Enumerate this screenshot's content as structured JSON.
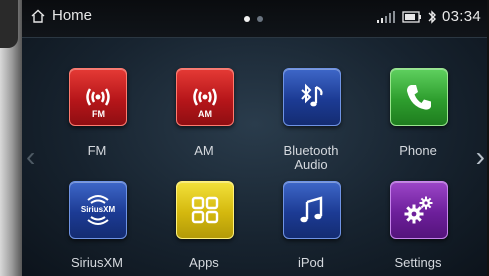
{
  "statusbar": {
    "title": "Home",
    "time": "03:34",
    "page_dots": 2,
    "active_dot": 0
  },
  "apps": [
    {
      "label": "FM",
      "icon": "fm-radio-icon",
      "color": "#c8201f",
      "badge": "FM"
    },
    {
      "label": "AM",
      "icon": "am-radio-icon",
      "color": "#c8201f",
      "badge": "AM"
    },
    {
      "label": "Bluetooth\nAudio",
      "icon": "bluetooth-audio-icon",
      "color": "#1f3f9c"
    },
    {
      "label": "Phone",
      "icon": "phone-icon",
      "color": "#35a835"
    },
    {
      "label": "SiriusXM",
      "icon": "siriusxm-icon",
      "color": "#1f3f9c",
      "badge": "SiriusXM"
    },
    {
      "label": "Apps",
      "icon": "apps-grid-icon",
      "color": "#d4b80e"
    },
    {
      "label": "iPod",
      "icon": "music-note-icon",
      "color": "#1f3f9c"
    },
    {
      "label": "Settings",
      "icon": "gears-icon",
      "color": "#6d1f9b"
    }
  ]
}
